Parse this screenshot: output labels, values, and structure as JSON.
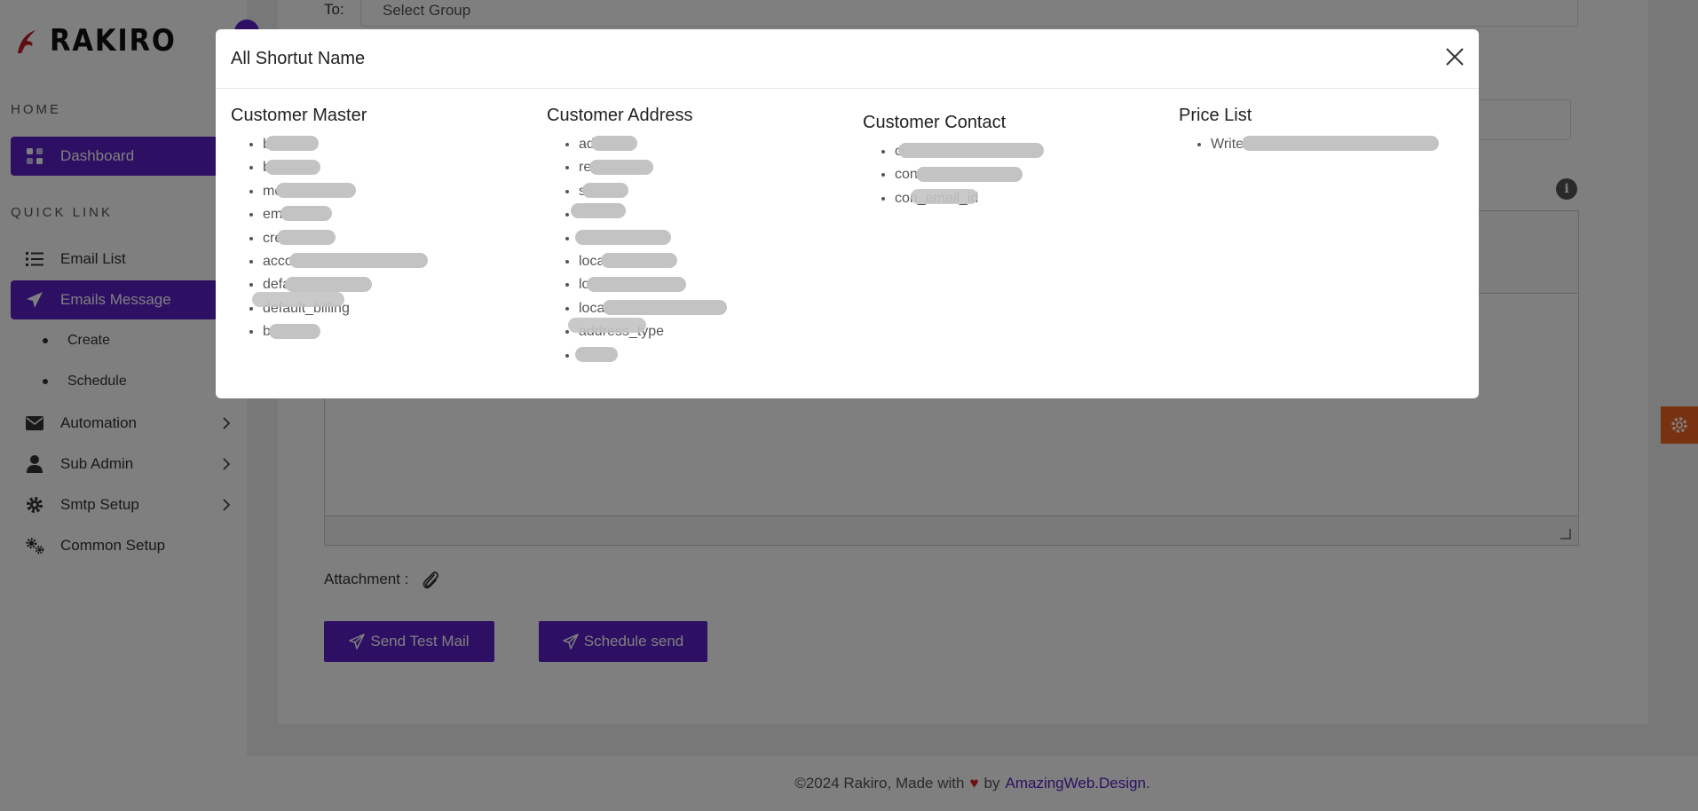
{
  "brand": {
    "name": "RAKIRO",
    "accent": "#5b1ec9"
  },
  "sidebar": {
    "home_label": "HOME",
    "quick_link_label": "QUICK LINK",
    "dashboard": "Dashboard",
    "items": [
      {
        "label": "Email List",
        "icon": "list-icon"
      },
      {
        "label": "Emails Message",
        "icon": "paper-plane-icon"
      },
      {
        "label": "Automation",
        "icon": "envelope-icon"
      },
      {
        "label": "Sub Admin",
        "icon": "user-icon"
      },
      {
        "label": "Smtp Setup",
        "icon": "gear-icon"
      },
      {
        "label": "Common Setup",
        "icon": "gears-icon"
      }
    ],
    "sub_items": [
      "Create",
      "Schedule"
    ]
  },
  "form": {
    "to_label": "To:",
    "to_value": "Select Group",
    "attachment_label": "Attachment :",
    "send_test_label": "Send Test Mail",
    "schedule_label": "Schedule send"
  },
  "footer": {
    "text_before": "©2024 Rakiro, Made with",
    "text_by": "by",
    "link": "AmazingWeb.Design",
    "text_after": "."
  },
  "modal": {
    "title": "All Shortut Name",
    "columns": [
      {
        "title": "Customer Master",
        "items": [
          "b",
          "b",
          "mob",
          "em",
          "cre",
          "acco",
          "defa",
          "default_billing",
          "b"
        ]
      },
      {
        "title": "Customer Address",
        "items": [
          "ad",
          "re",
          "s",
          "block",
          "",
          "loca",
          "location_country",
          "loca",
          "address_type",
          ""
        ]
      },
      {
        "title": "Customer Contact",
        "items": [
          "c",
          "con",
          "con_email_id"
        ]
      },
      {
        "title": "Price List",
        "items": [
          "Write"
        ]
      }
    ]
  }
}
